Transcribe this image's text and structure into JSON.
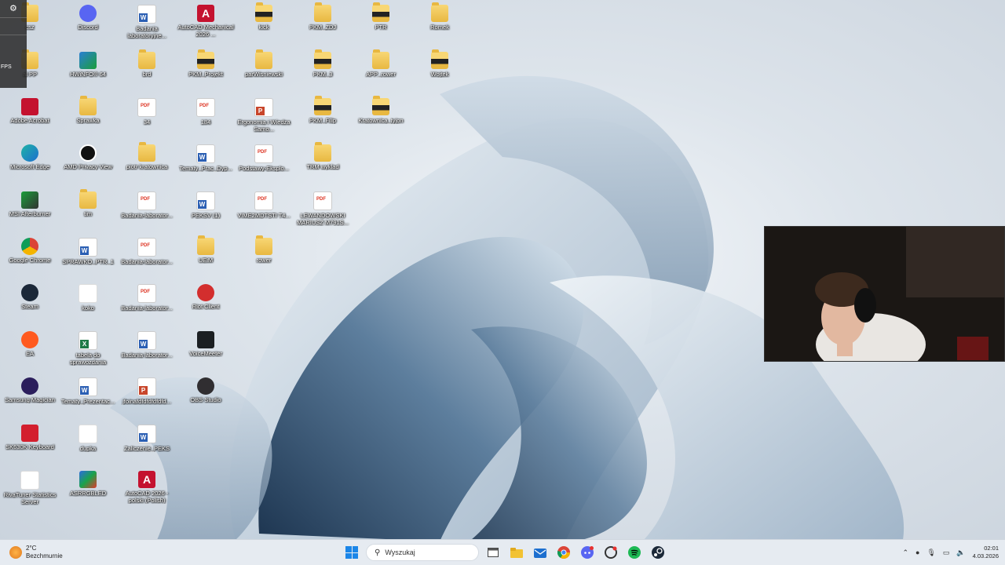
{
  "overlay": {
    "fps_label": "FPS"
  },
  "desktop_icons": [
    {
      "label": "csz",
      "kind": "folder"
    },
    {
      "label": "Discord",
      "kind": "discord"
    },
    {
      "label": "Badania laboratoryjne...",
      "kind": "word"
    },
    {
      "label": "AutoCAD Mechanical 2026 ...",
      "kind": "autocad"
    },
    {
      "label": "kick",
      "kind": "folder-dark"
    },
    {
      "label": "PKM_ZDJ",
      "kind": "folder"
    },
    {
      "label": "PTR",
      "kind": "folder-dark"
    },
    {
      "label": "Romek",
      "kind": "folder"
    },
    {
      "label": "al PP",
      "kind": "folder"
    },
    {
      "label": "HWiNFO® 64",
      "kind": "hwinfo"
    },
    {
      "label": "brd",
      "kind": "folder"
    },
    {
      "label": "PKM_Projekt",
      "kind": "folder-dark"
    },
    {
      "label": "parWisniewski",
      "kind": "folder"
    },
    {
      "label": "PKM_3",
      "kind": "folder-dark"
    },
    {
      "label": "APP_rower",
      "kind": "folder"
    },
    {
      "label": "Wojtek",
      "kind": "folder-dark"
    },
    {
      "label": "Adobe Acrobat",
      "kind": "acrobat"
    },
    {
      "label": "Sprawka",
      "kind": "folder"
    },
    {
      "label": "34",
      "kind": "pdf"
    },
    {
      "label": "184",
      "kind": "pdf"
    },
    {
      "label": "Ergonomia i Wiedza Samo...",
      "kind": "ppt"
    },
    {
      "label": "PKM_Filip",
      "kind": "folder-dark"
    },
    {
      "label": "Kratownica_tyjon",
      "kind": "folder-dark"
    },
    {
      "label": "Microsoft Edge",
      "kind": "edge"
    },
    {
      "label": "AMD Privacy View",
      "kind": "amd"
    },
    {
      "label": "piotr kratownica",
      "kind": "folder"
    },
    {
      "label": "Tematy_Prac_Dyp...",
      "kind": "word"
    },
    {
      "label": "Podstawy-Eksplo...",
      "kind": "pdf"
    },
    {
      "label": "TRM wyklad",
      "kind": "folder"
    },
    {
      "label": "MSI Afterburner",
      "kind": "msi"
    },
    {
      "label": "tim",
      "kind": "folder"
    },
    {
      "label": "Badania-laborator...",
      "kind": "pdf"
    },
    {
      "label": "PEKSV (1)",
      "kind": "word"
    },
    {
      "label": "VIME2MDTSTI T4...",
      "kind": "pdf"
    },
    {
      "label": "LEWANDOWSKI MARIUSZ M791S...",
      "kind": "pdf"
    },
    {
      "label": "Google Chrome",
      "kind": "chrome"
    },
    {
      "label": "SPRAWKO_PTR_1",
      "kind": "word"
    },
    {
      "label": "Badania-laborator...",
      "kind": "pdf"
    },
    {
      "label": "UEiM",
      "kind": "folder"
    },
    {
      "label": "rower",
      "kind": "folder"
    },
    {
      "label": "Steam",
      "kind": "steam"
    },
    {
      "label": "koko",
      "kind": "blank"
    },
    {
      "label": "Badania-laborator...",
      "kind": "pdf"
    },
    {
      "label": "Riot Client",
      "kind": "riot"
    },
    {
      "label": "EA",
      "kind": "ea"
    },
    {
      "label": "tabela do sprawozdania",
      "kind": "excel"
    },
    {
      "label": "Badania laborator...",
      "kind": "word"
    },
    {
      "label": "VoiceMeeter",
      "kind": "voicemeeter"
    },
    {
      "label": "Samsung Magician",
      "kind": "magician"
    },
    {
      "label": "Tematy_Prezentac...",
      "kind": "word"
    },
    {
      "label": "jfoinafdfdfdfdfdfd...",
      "kind": "ppt"
    },
    {
      "label": "OBS Studio",
      "kind": "obs"
    },
    {
      "label": "SK630K Keyboard",
      "kind": "keyboard"
    },
    {
      "label": "dupka",
      "kind": "blank"
    },
    {
      "label": "Zaliczenie_PEKS",
      "kind": "word"
    },
    {
      "label": "RivaTuner Statistics Server",
      "kind": "blank"
    },
    {
      "label": "ASRRGBLED",
      "kind": "asr"
    },
    {
      "label": "AutoCAD 2026 - polski (Polish)",
      "kind": "autocad"
    }
  ],
  "taskbar": {
    "weather_temp": "2°C",
    "weather_desc": "Bezchmurnie",
    "search_placeholder": "Wyszukaj",
    "time": "02:01",
    "date": "4.03.2026"
  }
}
